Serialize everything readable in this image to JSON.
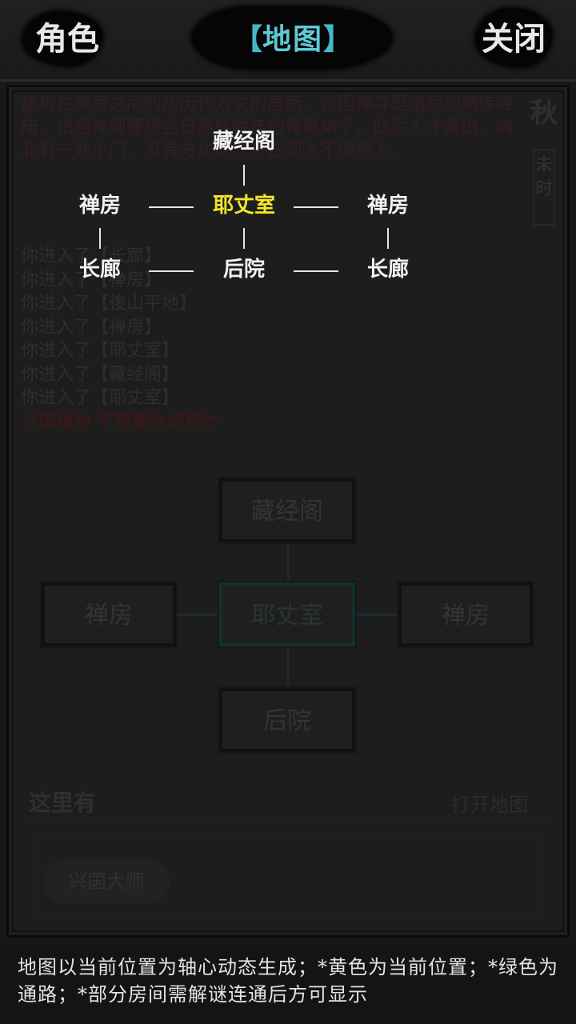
{
  "header": {
    "left_button": "角色",
    "title_open": "【",
    "title": "地图",
    "title_close": "】",
    "right_button": "关闭"
  },
  "background": {
    "description": "建构在禅房之间的乃历代方丈的居所，兴国禅寺是南宗的嫡传寺庙，始祖禅师便是当日慧能晚年的得意弟子，此后人才辈出，向北有一处小门，没有方丈的允许任何人不得擅入。",
    "season": "秋",
    "time": "未时",
    "log": [
      "你进入了【长廊】",
      "你进入了【禅房】",
      "你进入了【後山平地】",
      "你进入了【禅房】",
      "你进入了【耶丈室】",
      "你进入了【藏经阁】",
      "你进入了【耶丈室】"
    ],
    "log_alert": "兴国禅师 不想要你的帮忙",
    "rooms": {
      "top": "藏经阁",
      "left": "禅房",
      "center": "耶丈室",
      "right": "禅房",
      "bottom": "后院"
    },
    "here_label": "这里有",
    "open_map": "打开地图",
    "npc": "兴国大师"
  },
  "map": {
    "top": "藏经阁",
    "mid_left": "禅房",
    "current": "耶丈室",
    "mid_right": "禅房",
    "bottom_left": "长廊",
    "bottom_center": "后院",
    "bottom_right": "长廊"
  },
  "footer": {
    "note": "地图以当前位置为轴心动态生成；*黄色为当前位置；*绿色为通路；*部分房间需解谜连通后方可显示"
  },
  "colors": {
    "current_location": "#f5e62a",
    "title_accent": "#5fcad6",
    "node_text": "#f2f2f2"
  }
}
